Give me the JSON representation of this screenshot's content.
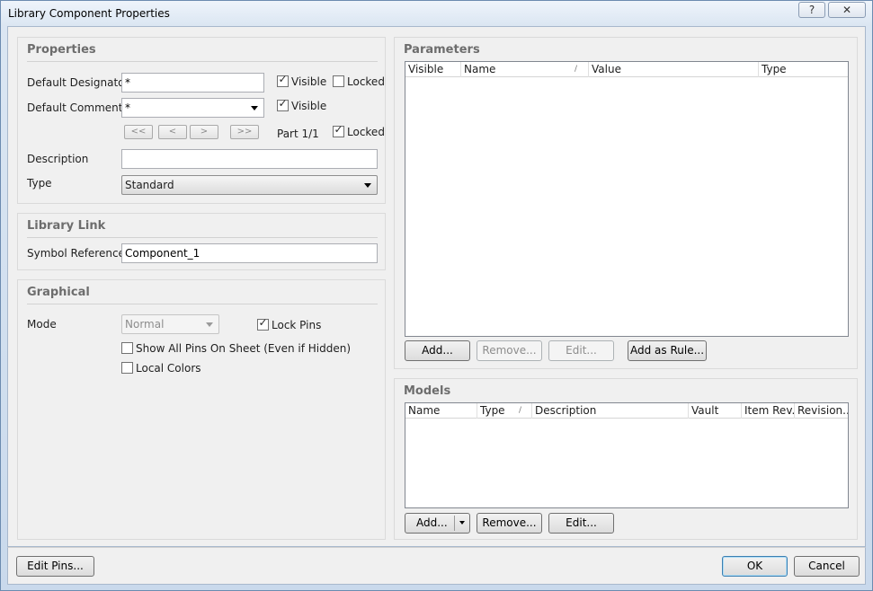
{
  "window": {
    "title": "Library Component Properties",
    "help_label": "?",
    "close_label": "✕"
  },
  "properties": {
    "title": "Properties",
    "designator_label": "Default Designator",
    "designator_value": "*",
    "designator_visible_label": "Visible",
    "designator_locked_label": "Locked",
    "comment_label": "Default Comment",
    "comment_value": "*",
    "comment_visible_label": "Visible",
    "nav_first": "<<",
    "nav_prev": "<",
    "nav_next": ">",
    "nav_last": ">>",
    "part_label": "Part 1/1",
    "part_locked_label": "Locked",
    "description_label": "Description",
    "description_value": "",
    "type_label": "Type",
    "type_value": "Standard"
  },
  "library_link": {
    "title": "Library Link",
    "symbol_ref_label": "Symbol Reference",
    "symbol_ref_value": "Component_1"
  },
  "graphical": {
    "title": "Graphical",
    "mode_label": "Mode",
    "mode_value": "Normal",
    "lock_pins_label": "Lock Pins",
    "show_all_pins_label": "Show All Pins On Sheet (Even if Hidden)",
    "local_colors_label": "Local Colors"
  },
  "parameters": {
    "title": "Parameters",
    "columns": [
      "Visible",
      "Name",
      "Value",
      "Type"
    ],
    "sort_marker": "/",
    "add_label": "Add...",
    "remove_label": "Remove...",
    "edit_label": "Edit...",
    "add_as_rule_label": "Add as Rule..."
  },
  "models": {
    "title": "Models",
    "columns": [
      "Name",
      "Type",
      "Description",
      "Vault",
      "Item Rev...",
      "Revision..."
    ],
    "sort_marker": "/",
    "add_label": "Add...",
    "remove_label": "Remove...",
    "edit_label": "Edit..."
  },
  "footer": {
    "edit_pins_label": "Edit Pins...",
    "ok_label": "OK",
    "cancel_label": "Cancel"
  },
  "states": {
    "designator_visible": true,
    "designator_locked": false,
    "comment_visible": true,
    "part_locked": true,
    "lock_pins": true,
    "show_all_pins": false,
    "local_colors": false
  },
  "icons": [
    "help-icon",
    "close-icon",
    "chevron-down-icon",
    "checkmark-icon"
  ]
}
